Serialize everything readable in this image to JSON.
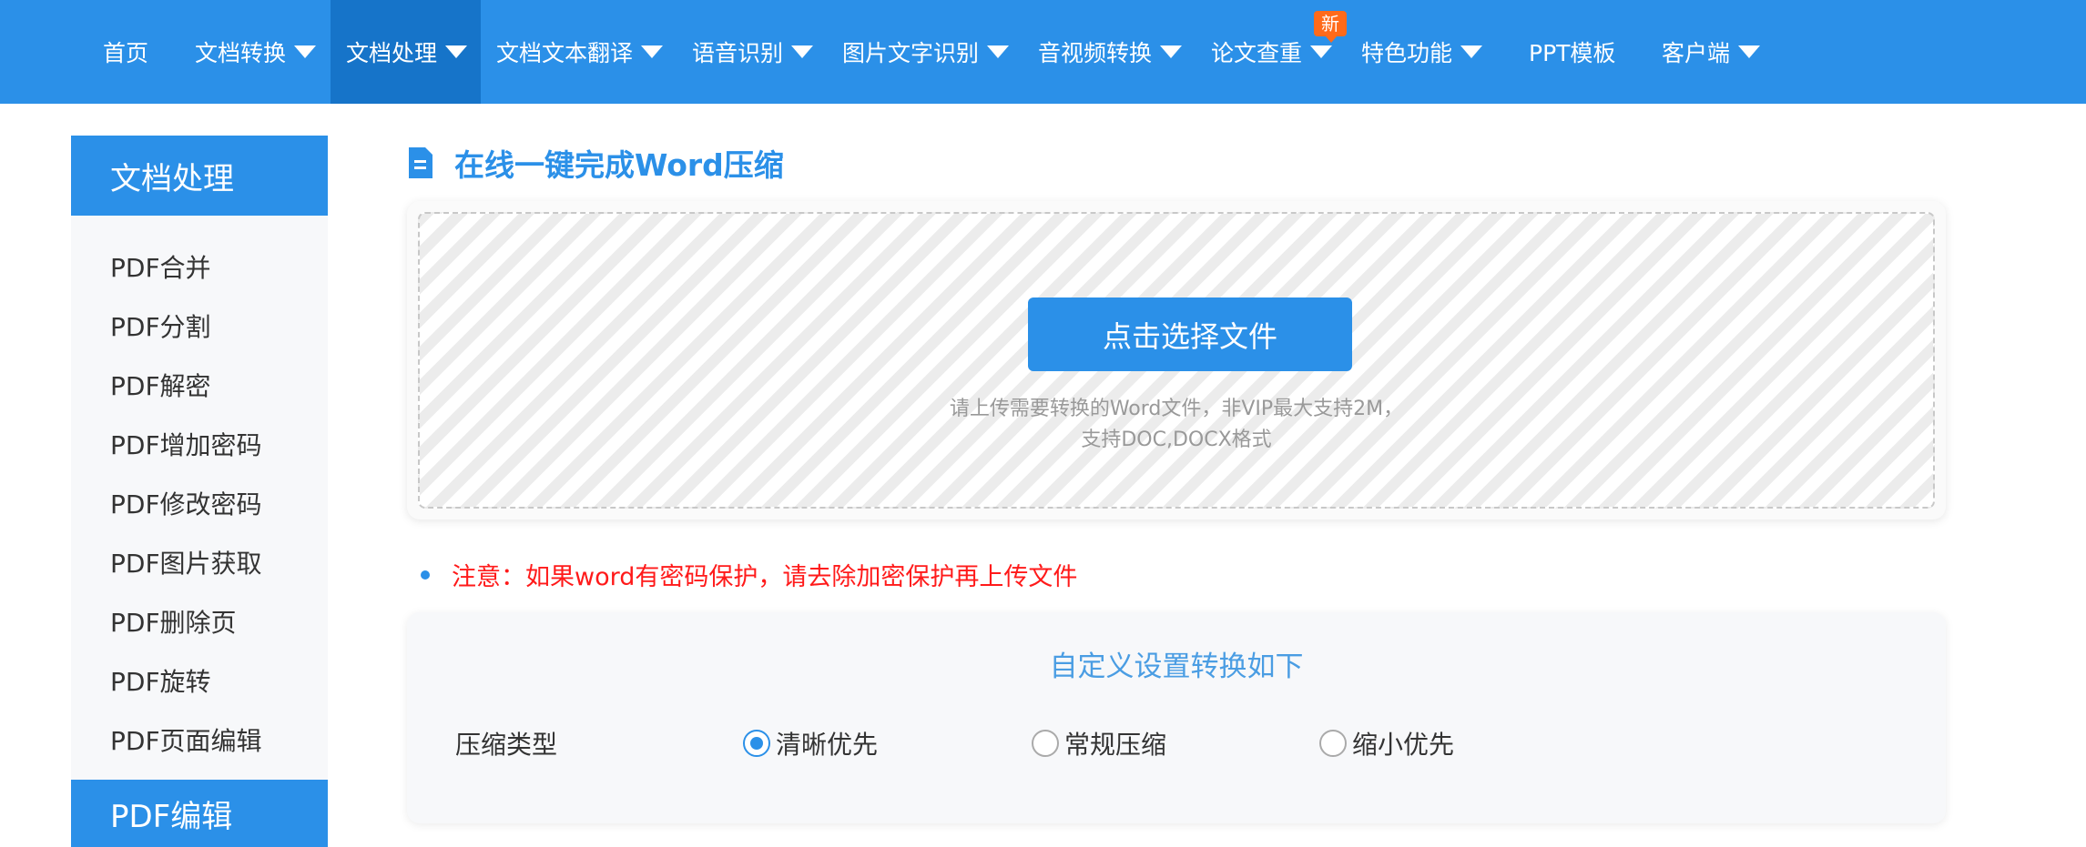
{
  "nav": {
    "items": [
      {
        "label": "首页",
        "has_dropdown": false,
        "active": false
      },
      {
        "label": "文档转换",
        "has_dropdown": true,
        "active": false
      },
      {
        "label": "文档处理",
        "has_dropdown": true,
        "active": true
      },
      {
        "label": "文档文本翻译",
        "has_dropdown": true,
        "active": false
      },
      {
        "label": "语音识别",
        "has_dropdown": true,
        "active": false
      },
      {
        "label": "图片文字识别",
        "has_dropdown": true,
        "active": false
      },
      {
        "label": "音视频转换",
        "has_dropdown": true,
        "active": false
      },
      {
        "label": "论文查重",
        "has_dropdown": true,
        "active": false
      },
      {
        "label": "特色功能",
        "has_dropdown": true,
        "active": false
      },
      {
        "label": "PPT模板",
        "has_dropdown": false,
        "active": false
      },
      {
        "label": "客户端",
        "has_dropdown": true,
        "active": false
      }
    ],
    "new_badge": "新",
    "colors": {
      "background": "#2b90e8",
      "active_background": "#1674c9",
      "badge": "#ff6a1a"
    }
  },
  "sidebar": {
    "section_title": "文档处理",
    "items": [
      {
        "label": "PDF合并"
      },
      {
        "label": "PDF分割"
      },
      {
        "label": "PDF解密"
      },
      {
        "label": "PDF增加密码"
      },
      {
        "label": "PDF修改密码"
      },
      {
        "label": "PDF图片获取"
      },
      {
        "label": "PDF删除页"
      },
      {
        "label": "PDF旋转"
      },
      {
        "label": "PDF页面编辑"
      }
    ],
    "next_section_title": "PDF编辑"
  },
  "main": {
    "title": "在线一键完成Word压缩",
    "upload": {
      "button_label": "点击选择文件",
      "hint_line1": "请上传需要转换的Word文件，非VIP最大支持2M，",
      "hint_line2": "支持DOC,DOCX格式"
    },
    "notice": "注意：如果word有密码保护，请去除加密保护再上传文件",
    "settings": {
      "title": "自定义设置转换如下",
      "label": "压缩类型",
      "options": [
        {
          "label": "清晰优先",
          "checked": true
        },
        {
          "label": "常规压缩",
          "checked": false
        },
        {
          "label": "缩小优先",
          "checked": false
        }
      ]
    }
  },
  "colors": {
    "accent": "#2b90e8",
    "notice": "#ff1a1a"
  }
}
